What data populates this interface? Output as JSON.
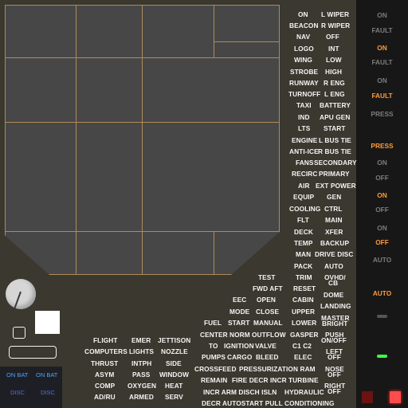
{
  "labels": {
    "on_l_wiper": "ON",
    "l_wiper": "L WIPER",
    "beacon": "BEACON",
    "r_wiper": "R WIPER",
    "nav": "NAV",
    "off_top": "OFF",
    "logo": "LOGO",
    "int": "INT",
    "wing": "WING",
    "low": "LOW",
    "strobe": "STROBE",
    "high": "HIGH",
    "runway": "RUNWAY",
    "r_eng": "R ENG",
    "turnoff": "TURNOFF",
    "l_eng": "L ENG",
    "taxi": "TAXI",
    "battery": "BATTERY",
    "ind": "IND",
    "apu_gen": "APU GEN",
    "lts": "LTS",
    "start": "START",
    "engine": "ENGINE",
    "l_bus_tie": "L BUS TIE",
    "anti_ice": "ANTI-ICE",
    "r_bus_tie": "R BUS TIE",
    "fans": "FANS",
    "secondary": "SECONDARY",
    "recirc": "RECIRC",
    "primary": "PRIMARY",
    "air": "AIR",
    "ext_power": "EXT POWER",
    "equip": "EQUIP",
    "gen": "GEN",
    "cooling": "COOLING",
    "ctrl": "CTRL",
    "flt": "FLT",
    "main": "MAIN",
    "deck": "DECK",
    "xfer": "XFER",
    "temp": "TEMP",
    "backup": "BACKUP",
    "man": "MAN",
    "drive_disc": "DRIVE DISC",
    "pack": "PACK",
    "auto": "AUTO",
    "test": "TEST",
    "trim": "TRIM",
    "ovhd_cb_line1": "OVHD/",
    "ovhd_cb_line2": "CB",
    "fwd_aft": "FWD AFT",
    "reset": "RESET",
    "eec": "EEC",
    "open": "OPEN",
    "cabin": "CABIN",
    "dome": "DOME",
    "mode": "MODE",
    "close": "CLOSE",
    "upper": "UPPER",
    "landing": "LANDING",
    "fuel": "FUEL",
    "start2": "START",
    "manual": "MANUAL",
    "lower": "LOWER",
    "master_bright_line1": "MASTER",
    "master_bright_line2": "BRIGHT",
    "center": "CENTER",
    "norm": "NORM",
    "outflow": "OUTFLOW",
    "gasper": "GASPER",
    "push_on_off_line1": "PUSH",
    "push_on_off_line2": "ON/OFF",
    "to": "TO",
    "ignition": "IGNITION",
    "valve": "VALVE",
    "c1_c2": "C1  C2",
    "left_off_line1": "LEFT",
    "left_off_line2": "OFF",
    "pumps": "PUMPS",
    "cargo": "CARGO",
    "bleed": "BLEED",
    "elec": "ELEC",
    "nose_off_line1": "NOSE",
    "nose_off_line2": "OFF",
    "crossfeed": "CROSSFEED",
    "pressurization_ram": "PRESSURIZATION RAM",
    "remain": "REMAIN",
    "fire_decr_incr": "FIRE  DECR  INCR",
    "turbine": "TURBINE",
    "right_off_line1": "RIGHT",
    "right_off_line2": "OFF",
    "incr_arm_disch_isln": "INCR  ARM  DISCH ISLN",
    "hydraulic": "HYDRAULIC",
    "decr_autostart_pull_conditioning": "DECR AUTOSTART PULL  CONDITIONING",
    "flight": "FLIGHT",
    "emer": "EMER",
    "jettison": "JETTISON",
    "computers": "COMPUTERS",
    "lights": "LIGHTS",
    "nozzle": "NOZZLE",
    "thrust": "THRUST",
    "intph": "INTPH",
    "side": "SIDE",
    "asym": "ASYM",
    "pass": "PASS",
    "window": "WINDOW",
    "comp": "COMP",
    "oxygen": "OXYGEN",
    "heat": "HEAT",
    "adru": "AD/RU",
    "armed": "ARMED",
    "serv": "SERV"
  },
  "bottom_left": {
    "on_bat_1": "ON BAT",
    "on_bat_2": "ON BAT",
    "disc_1": "DISC",
    "disc_2": "DISC"
  },
  "status_column": [
    {
      "text": "ON",
      "color": "#7c7c7c"
    },
    {
      "text": "FAULT",
      "color": "#7c7c7c"
    },
    {
      "text": "ON",
      "color": "#ff9b3a"
    },
    {
      "text": "FAULT",
      "color": "#7c7c7c"
    },
    {
      "text": "ON",
      "color": "#7c7c7c"
    },
    {
      "text": "FAULT",
      "color": "#ff9b3a"
    },
    {
      "text": "PRESS",
      "color": "#7c7c7c"
    },
    {
      "text": "PRESS",
      "color": "#ff9b3a"
    },
    {
      "text": "ON",
      "color": "#7c7c7c"
    },
    {
      "text": "OFF",
      "color": "#7c7c7c"
    },
    {
      "text": "ON",
      "color": "#ff9b3a"
    },
    {
      "text": "OFF",
      "color": "#7c7c7c"
    },
    {
      "text": "ON",
      "color": "#7c7c7c"
    },
    {
      "text": "OFF",
      "color": "#ff9b3a"
    },
    {
      "text": "AUTO",
      "color": "#7c7c7c"
    },
    {
      "text": "AUTO",
      "color": "#ff9b3a"
    }
  ],
  "colors": {
    "accent_orange": "#ff9b3a",
    "inactive_gray": "#7c7c7c",
    "indicator_green": "#3cff4c",
    "indicator_red": "#ff4b4b",
    "panel_border": "#b08a5a",
    "blue_text": "#4aa3ff"
  }
}
